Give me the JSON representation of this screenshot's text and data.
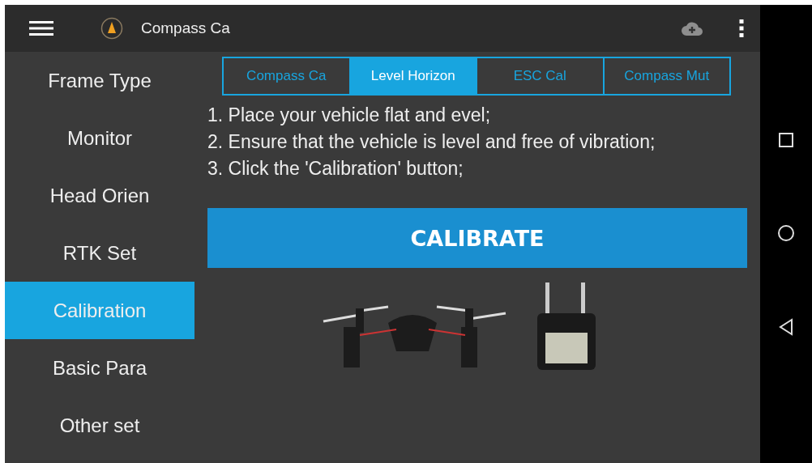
{
  "app_bar": {
    "title": "Compass Ca"
  },
  "sidebar": {
    "items": [
      {
        "label": "Frame Type",
        "selected": false
      },
      {
        "label": "Monitor",
        "selected": false
      },
      {
        "label": "Head Orien",
        "selected": false
      },
      {
        "label": "RTK Set",
        "selected": false
      },
      {
        "label": "Calibration",
        "selected": true
      },
      {
        "label": "Basic Para",
        "selected": false
      },
      {
        "label": "Other set",
        "selected": false
      }
    ]
  },
  "tabs": [
    {
      "label": "Compass Ca",
      "selected": false
    },
    {
      "label": "Level Horizon",
      "selected": true
    },
    {
      "label": "ESC Cal",
      "selected": false
    },
    {
      "label": "Compass Mut",
      "selected": false
    }
  ],
  "instructions": [
    "1. Place your vehicle flat and  evel;",
    "2. Ensure that the vehicle is level and free of vibration;",
    "3. Click the 'Calibration' button;"
  ],
  "calibrate_button": {
    "label": "CALIBRATE"
  }
}
